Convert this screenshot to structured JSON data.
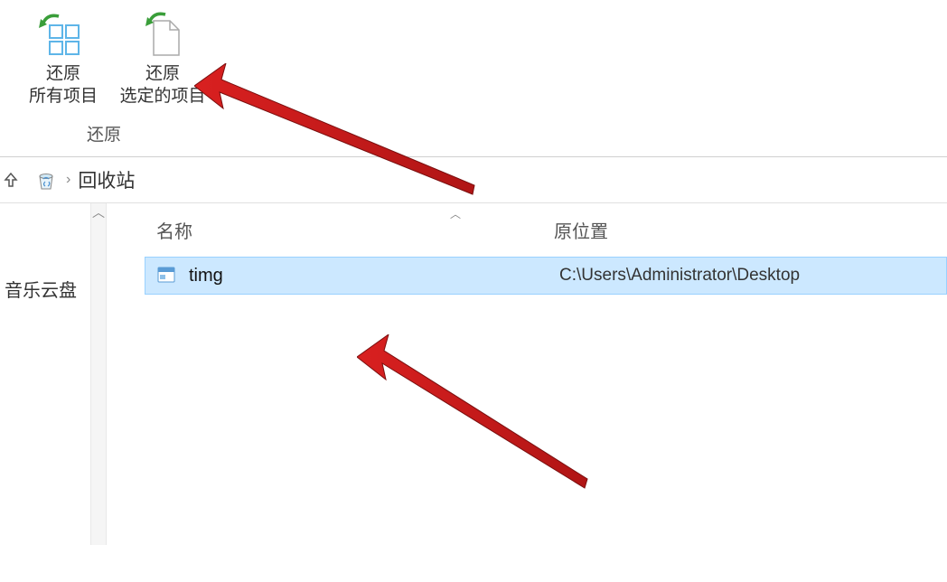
{
  "ribbon": {
    "restore_all": {
      "label_line1": "还原",
      "label_line2": "所有项目"
    },
    "restore_selected": {
      "label_line1": "还原",
      "label_line2": "选定的项目"
    },
    "group_label": "还原"
  },
  "breadcrumb": {
    "location": "回收站"
  },
  "sidebar": {
    "music_cloud": "音乐云盘"
  },
  "columns": {
    "name": "名称",
    "original_location": "原位置"
  },
  "files": [
    {
      "name": "timg",
      "original_location": "C:\\Users\\Administrator\\Desktop"
    }
  ]
}
